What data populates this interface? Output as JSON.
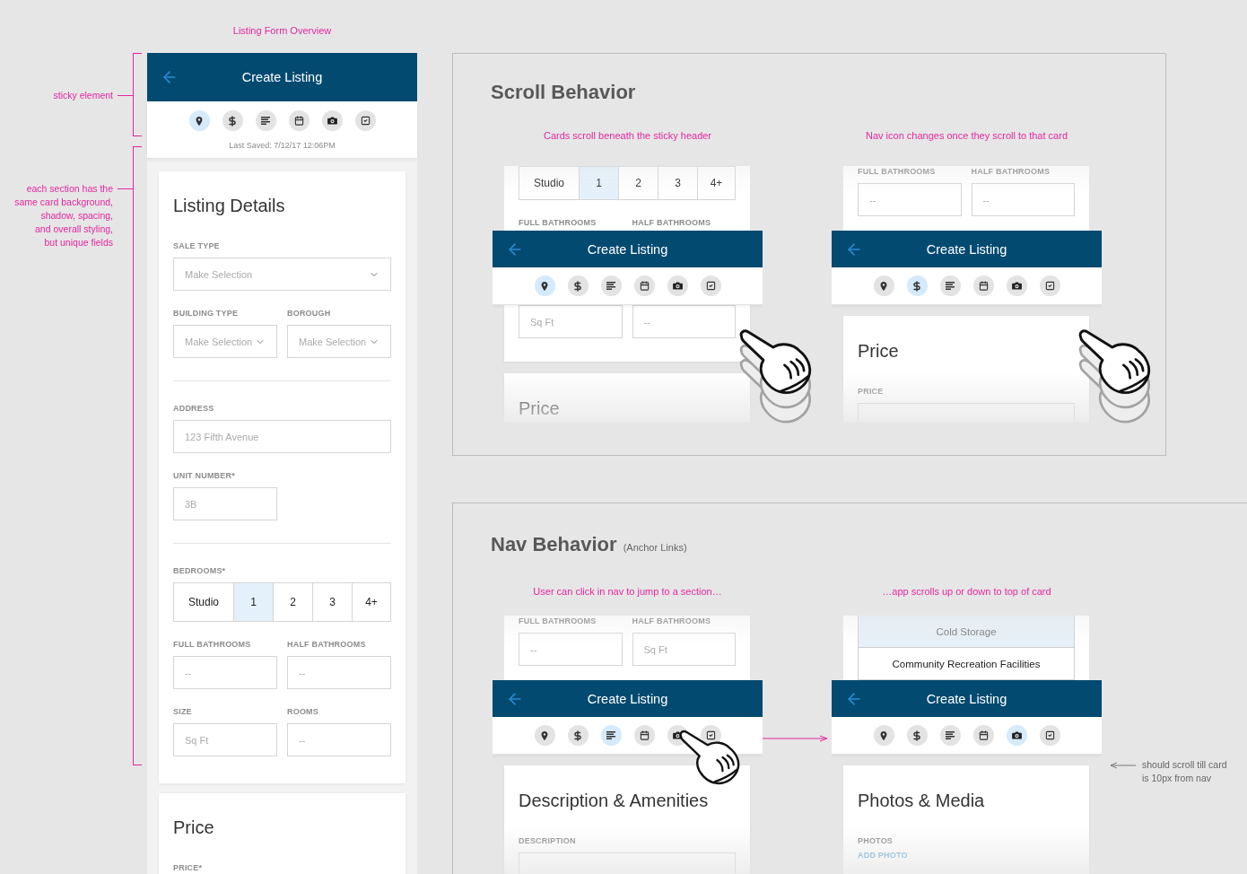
{
  "overview": {
    "title": "Listing Form Overview",
    "annotations": [
      {
        "text": "sticky element"
      },
      {
        "text": "each section has the\nsame card background,\nshadow, spacing,\nand overall styling,\nbut unique fields"
      }
    ],
    "screen": {
      "header": {
        "title": "Create Listing"
      },
      "nav": [
        {
          "kind": "location",
          "selected": true
        },
        {
          "kind": "price",
          "selected": false
        },
        {
          "kind": "description",
          "selected": false
        },
        {
          "kind": "schedule",
          "selected": false
        },
        {
          "kind": "media",
          "selected": false
        },
        {
          "kind": "review",
          "selected": false
        }
      ],
      "last_saved": "Last Saved: 7/12/17 12:06PM",
      "cards": [
        {
          "title": "Listing Details",
          "rows": [
            {
              "kind": "full",
              "fields": [
                {
                  "label": "SALE TYPE",
                  "kind": "select",
                  "placeholder": "Make Selection"
                }
              ]
            },
            {
              "kind": "pair",
              "fields": [
                {
                  "label": "BUILDING TYPE",
                  "kind": "select",
                  "placeholder": "Make Selection"
                },
                {
                  "label": "BOROUGH",
                  "kind": "select",
                  "placeholder": "Make Selection"
                }
              ]
            },
            {
              "kind": "divider"
            },
            {
              "kind": "full",
              "fields": [
                {
                  "label": "ADDRESS",
                  "kind": "input",
                  "placeholder": "123 Fifth Avenue"
                }
              ]
            },
            {
              "kind": "pair",
              "fields": [
                {
                  "label": "UNIT NUMBER*",
                  "kind": "input",
                  "placeholder": "3B"
                }
              ]
            },
            {
              "kind": "divider"
            },
            {
              "kind": "segments",
              "label": "BEDROOMS*",
              "options": [
                {
                  "label": "Studio",
                  "selected": false
                },
                {
                  "label": "1",
                  "selected": true
                },
                {
                  "label": "2",
                  "selected": false
                },
                {
                  "label": "3",
                  "selected": false
                },
                {
                  "label": "4+",
                  "selected": false
                }
              ]
            },
            {
              "kind": "pair",
              "fields": [
                {
                  "label": "FULL BATHROOMS",
                  "kind": "input",
                  "placeholder": "--"
                },
                {
                  "label": "HALF BATHROOMS",
                  "kind": "input",
                  "placeholder": "--"
                }
              ]
            },
            {
              "kind": "pair",
              "fields": [
                {
                  "label": "SIZE",
                  "kind": "input",
                  "placeholder": "Sq Ft"
                },
                {
                  "label": "ROOMS",
                  "kind": "input",
                  "placeholder": "--"
                }
              ]
            }
          ]
        },
        {
          "title": "Price",
          "rows": [
            {
              "kind": "full",
              "fields": [
                {
                  "label": "PRICE*"
                }
              ]
            }
          ]
        }
      ]
    }
  },
  "scroll_behavior": {
    "title": "Scroll Behavior",
    "frames": [
      {
        "caption": "Cards scroll beneath the sticky header",
        "top": [
          {
            "kind": "segments",
            "options": [
              {
                "label": "Studio",
                "selected": false
              },
              {
                "label": "1",
                "selected": true
              },
              {
                "label": "2",
                "selected": false
              },
              {
                "label": "3",
                "selected": false
              },
              {
                "label": "4+",
                "selected": false
              }
            ]
          },
          {
            "kind": "pair",
            "fields": [
              {
                "label": "FULL BATHROOMS"
              },
              {
                "label": "HALF BATHROOMS"
              }
            ]
          }
        ],
        "header": {
          "title": "Create Listing"
        },
        "nav": [
          {
            "kind": "location",
            "selected": true
          },
          {
            "kind": "price",
            "selected": false
          },
          {
            "kind": "description",
            "selected": false
          },
          {
            "kind": "schedule",
            "selected": false
          },
          {
            "kind": "media",
            "selected": false
          },
          {
            "kind": "review",
            "selected": false
          }
        ],
        "rest": [
          {
            "kind": "pair",
            "fields": [
              {
                "kind": "input",
                "placeholder": "Sq Ft"
              },
              {
                "kind": "input",
                "placeholder": "--"
              }
            ]
          }
        ],
        "next_card": {
          "title": "Price"
        },
        "hand": {
          "kind": "swipe"
        }
      },
      {
        "caption": "Nav icon changes once they scroll to that card",
        "top": [
          {
            "kind": "pair",
            "fields": [
              {
                "label": "FULL BATHROOMS",
                "kind": "input",
                "placeholder": "--"
              },
              {
                "label": "HALF BATHROOMS",
                "kind": "input",
                "placeholder": "--"
              }
            ]
          }
        ],
        "header": {
          "title": "Create Listing"
        },
        "nav": [
          {
            "kind": "location",
            "selected": false
          },
          {
            "kind": "price",
            "selected": true
          },
          {
            "kind": "description",
            "selected": false
          },
          {
            "kind": "schedule",
            "selected": false
          },
          {
            "kind": "media",
            "selected": false
          },
          {
            "kind": "review",
            "selected": false
          }
        ],
        "next_card": {
          "title": "Price",
          "rows": [
            {
              "kind": "full",
              "fields": [
                {
                  "label": "PRICE",
                  "kind": "input"
                }
              ]
            }
          ]
        },
        "hand": {
          "kind": "swipe"
        }
      }
    ]
  },
  "nav_behavior": {
    "title": "Nav Behavior",
    "subtitle": "(Anchor Links)",
    "frames": [
      {
        "caption": "User can click in nav to jump to a section…",
        "top": [
          {
            "kind": "pair",
            "fields": [
              {
                "label": "FULL BATHROOMS",
                "kind": "input",
                "placeholder": "--"
              },
              {
                "label": "HALF BATHROOMS",
                "kind": "input",
                "placeholder": "Sq Ft"
              }
            ]
          }
        ],
        "header": {
          "title": "Create Listing"
        },
        "nav": [
          {
            "kind": "location",
            "selected": false
          },
          {
            "kind": "price",
            "selected": false
          },
          {
            "kind": "description",
            "selected": true
          },
          {
            "kind": "schedule",
            "selected": false
          },
          {
            "kind": "media",
            "selected": false
          },
          {
            "kind": "review",
            "selected": false
          }
        ],
        "next_card": {
          "title": "Description & Amenities",
          "rows": [
            {
              "kind": "full",
              "fields": [
                {
                  "label": "DESCRIPTION",
                  "kind": "input"
                }
              ]
            }
          ]
        },
        "hand": {
          "kind": "tap"
        }
      },
      {
        "caption": "…app scrolls up or down to top of card",
        "top": [
          {
            "kind": "options",
            "options": [
              {
                "label": "Cold Storage",
                "selected": true
              },
              {
                "label": "Community Recreation Facilities",
                "selected": false
              }
            ]
          }
        ],
        "header": {
          "title": "Create Listing"
        },
        "nav": [
          {
            "kind": "location",
            "selected": false
          },
          {
            "kind": "price",
            "selected": false
          },
          {
            "kind": "description",
            "selected": false
          },
          {
            "kind": "schedule",
            "selected": false
          },
          {
            "kind": "media",
            "selected": true
          },
          {
            "kind": "review",
            "selected": false
          }
        ],
        "next_card": {
          "title": "Photos & Media",
          "rows": [
            {
              "kind": "full",
              "fields": [
                {
                  "label": "PHOTOS",
                  "link": "ADD PHOTO"
                }
              ]
            }
          ]
        }
      }
    ],
    "note": "should scroll till card\nis 10px from nav"
  }
}
